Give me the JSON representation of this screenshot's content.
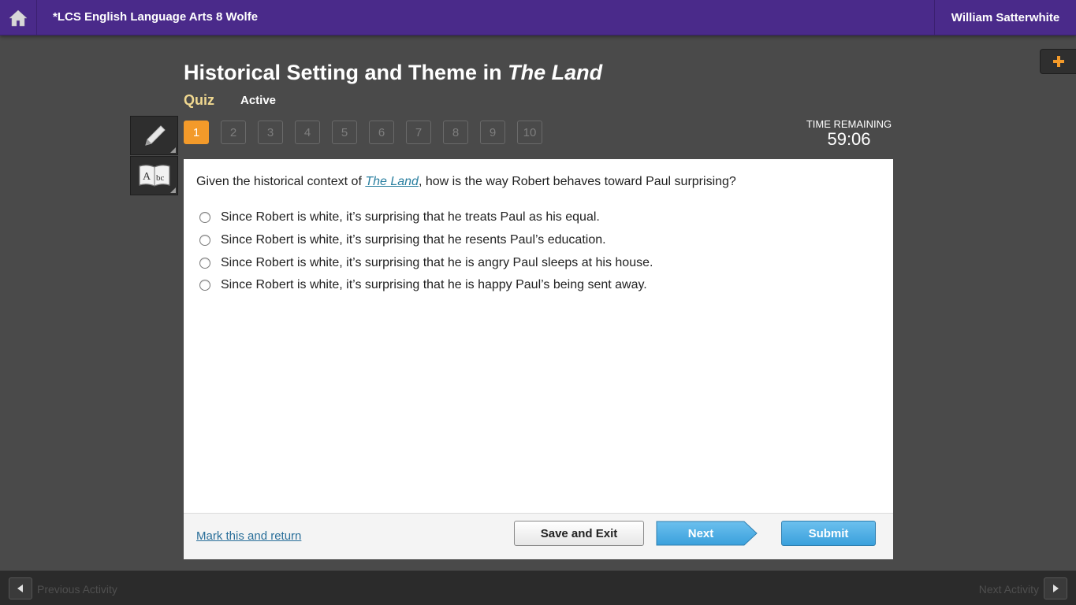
{
  "header": {
    "home_icon": "home-icon",
    "course_title": "*LCS English Language Arts 8 Wolfe",
    "user_name": "William Satterwhite",
    "accent_color": "#4a2a8a"
  },
  "toolbar": {
    "plus_icon": "plus-icon",
    "tools": [
      {
        "name": "pencil-tool",
        "icon": "pencil-icon"
      },
      {
        "name": "dictionary-tool",
        "icon": "dictionary-book-icon"
      }
    ]
  },
  "activity": {
    "title_prefix": "Historical Setting and Theme in ",
    "title_italic": "The Land",
    "type": "Quiz",
    "status": "Active"
  },
  "question_nav": {
    "current": "1",
    "numbers": [
      "1",
      "2",
      "3",
      "4",
      "5",
      "6",
      "7",
      "8",
      "9",
      "10"
    ],
    "active_color": "#f39a2a"
  },
  "timer": {
    "label": "TIME REMAINING",
    "value": "59:06"
  },
  "question": {
    "text_before": "Given the historical context of ",
    "link_text": "The Land",
    "text_after": ", how is the way Robert behaves toward Paul surprising?",
    "options": [
      "Since Robert is white, it’s surprising that he treats Paul as his equal.",
      "Since Robert is white, it’s surprising that he resents Paul’s education.",
      "Since Robert is white, it’s surprising that he is angry Paul sleeps at his house.",
      "Since Robert is white, it’s surprising that he is happy Paul’s being sent away."
    ]
  },
  "footer": {
    "mark_link": "Mark this and return",
    "save_label": "Save and Exit",
    "next_label": "Next",
    "submit_label": "Submit"
  },
  "bottom_nav": {
    "previous_label": "Previous Activity",
    "next_label": "Next Activity"
  }
}
